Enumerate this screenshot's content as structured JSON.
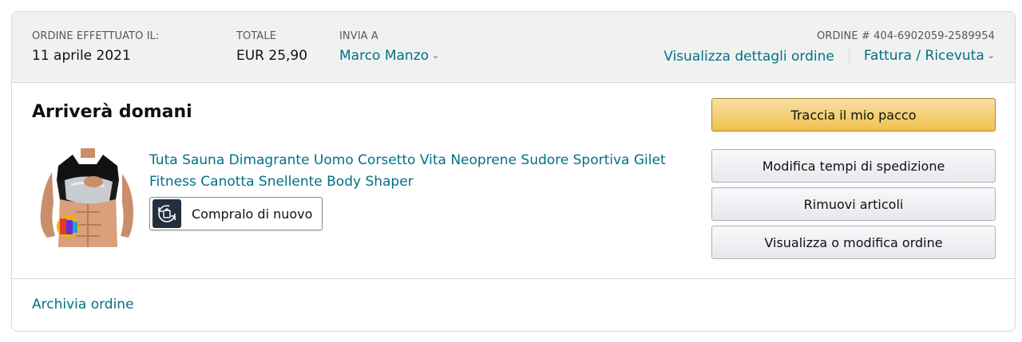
{
  "header": {
    "order_placed_label": "ORDINE EFFETTUATO IL:",
    "order_date": "11 aprile 2021",
    "total_label": "TOTALE",
    "total_value": "EUR 25,90",
    "ship_to_label": "INVIA A",
    "ship_to_name": "Marco Manzo",
    "order_number": "ORDINE # 404-6902059-2589954",
    "order_details_link": "Visualizza dettagli ordine",
    "invoice_link": "Fattura / Ricevuta"
  },
  "shipment": {
    "status": "Arriverà domani",
    "product_title": "Tuta Sauna Dimagrante Uomo Corsetto Vita Neoprene Sudore Sportiva Gilet Fitness Canotta Snellente Body Shaper",
    "buy_again_label": "Compralo di nuovo"
  },
  "actions": {
    "track_package": "Traccia il mio pacco",
    "change_delivery": "Modifica tempi di spedizione",
    "remove_items": "Rimuovi articoli",
    "view_edit_order": "Visualizza o modifica ordine"
  },
  "footer": {
    "archive_link": "Archivia ordine"
  },
  "colors": {
    "link": "#007185",
    "primary_button": "#f0c14b",
    "header_bg": "#f0f2f2"
  }
}
